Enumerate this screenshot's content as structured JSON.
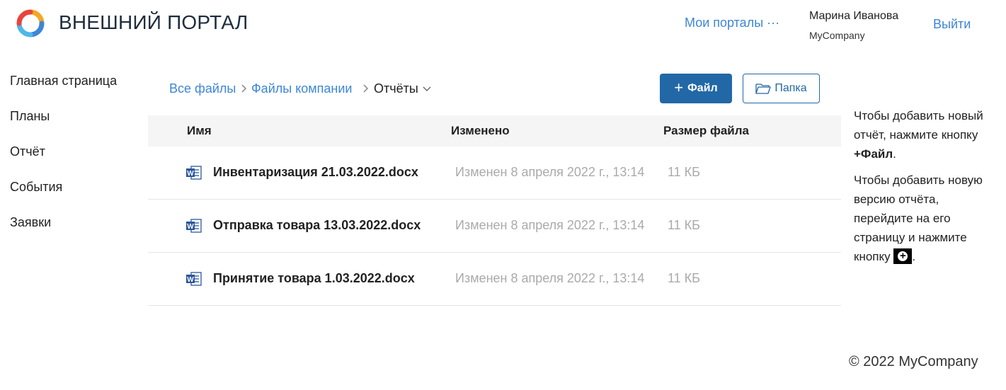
{
  "header": {
    "brand": "ВНЕШНИЙ ПОРТАЛ",
    "my_portals": "Мои порталы ···",
    "user_name": "Марина Иванова",
    "user_company": "MyCompany",
    "logout": "Выйти"
  },
  "sidebar": {
    "items": [
      {
        "label": "Главная страница"
      },
      {
        "label": "Планы"
      },
      {
        "label": "Отчёт"
      },
      {
        "label": "События"
      },
      {
        "label": "Заявки"
      }
    ]
  },
  "breadcrumb": {
    "items": [
      {
        "label": "Все файлы"
      },
      {
        "label": "Файлы компании"
      },
      {
        "label": "Отчёты"
      }
    ]
  },
  "toolbar": {
    "add_file_plus": "+",
    "add_file_label": "Файл",
    "add_folder_label": "Папка"
  },
  "table": {
    "columns": [
      "Имя",
      "Изменено",
      "Размер файла"
    ],
    "rows": [
      {
        "name": "Инвентаризация 21.03.2022.docx",
        "modified": "Изменен 8 апреля 2022 г., 13:14",
        "size": "11 КБ"
      },
      {
        "name": "Отправка товара 13.03.2022.docx",
        "modified": "Изменен 8 апреля 2022 г., 13:14",
        "size": "11 КБ"
      },
      {
        "name": "Принятие товара 1.03.2022.docx",
        "modified": "Изменен 8 апреля 2022 г., 13:14",
        "size": "11 КБ"
      }
    ]
  },
  "help": {
    "p1_text": "Чтобы добавить новый отчёт, нажмите кнопку ",
    "p1_bold": "+Файл",
    "p1_end": ".",
    "p2_text": "Чтобы добавить новую версию отчёта, перейдите на его страницу и нажмите кнопку ",
    "p2_end": "."
  },
  "footer": {
    "copyright": "© 2022 MyCompany"
  },
  "colors": {
    "accent": "#3d86d6",
    "primary_button": "#2268a6",
    "muted_text": "#aaaaaa",
    "table_header_bg": "#f5f5f5",
    "word_icon": "#2b579a"
  },
  "icons": {
    "logo": "elma-logo-icon",
    "chevron": "chevron-down-icon",
    "folder": "folder-icon",
    "word": "word-document-icon",
    "plus_circle": "plus-circle-icon"
  }
}
